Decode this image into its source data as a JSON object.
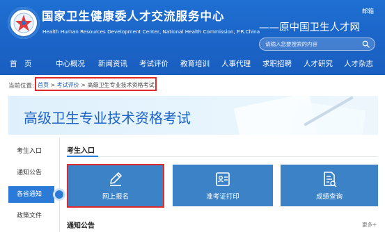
{
  "header": {
    "org_name_cn": "国家卫生健康委人才交流服务中心",
    "org_name_en": "Health Human Resources Development Center, National Health Commission, P.R.China",
    "tagline": "——原中国卫生人才网",
    "mailbox_label": "邮箱",
    "search_placeholder": "请输入您要搜索的内容",
    "brand_color": "#1b63c6"
  },
  "nav": {
    "items": [
      {
        "label": "首　页"
      },
      {
        "label": "中心概况"
      },
      {
        "label": "新闻资讯"
      },
      {
        "label": "考试评价"
      },
      {
        "label": "教育培训"
      },
      {
        "label": "人事代理"
      },
      {
        "label": "求职招聘"
      },
      {
        "label": "人才研究"
      },
      {
        "label": "人才杂志"
      }
    ]
  },
  "breadcrumb": {
    "prefix": "当前位置:",
    "items": [
      "首页",
      "考试评价",
      "高级卫生专业技术资格考试"
    ],
    "separator": " > "
  },
  "banner": {
    "title": "高级卫生专业技术资格考试"
  },
  "sidebar": {
    "items": [
      {
        "label": "考生入口",
        "active": false
      },
      {
        "label": "通知公告",
        "active": false
      },
      {
        "label": "各省通知",
        "active": true
      },
      {
        "label": "政策文件",
        "active": false
      }
    ]
  },
  "main": {
    "section_title": "考生入口",
    "cards": [
      {
        "label": "网上报名",
        "icon": "pencil-icon"
      },
      {
        "label": "准考证打印",
        "icon": "id-card-icon"
      },
      {
        "label": "成绩查询",
        "icon": "document-search-icon"
      }
    ],
    "notice_title": "通知公告",
    "more_label": "更多+"
  },
  "colors": {
    "accent": "#2c7ad8",
    "card": "#3b82c7",
    "highlight_box": "#e02b2b"
  }
}
